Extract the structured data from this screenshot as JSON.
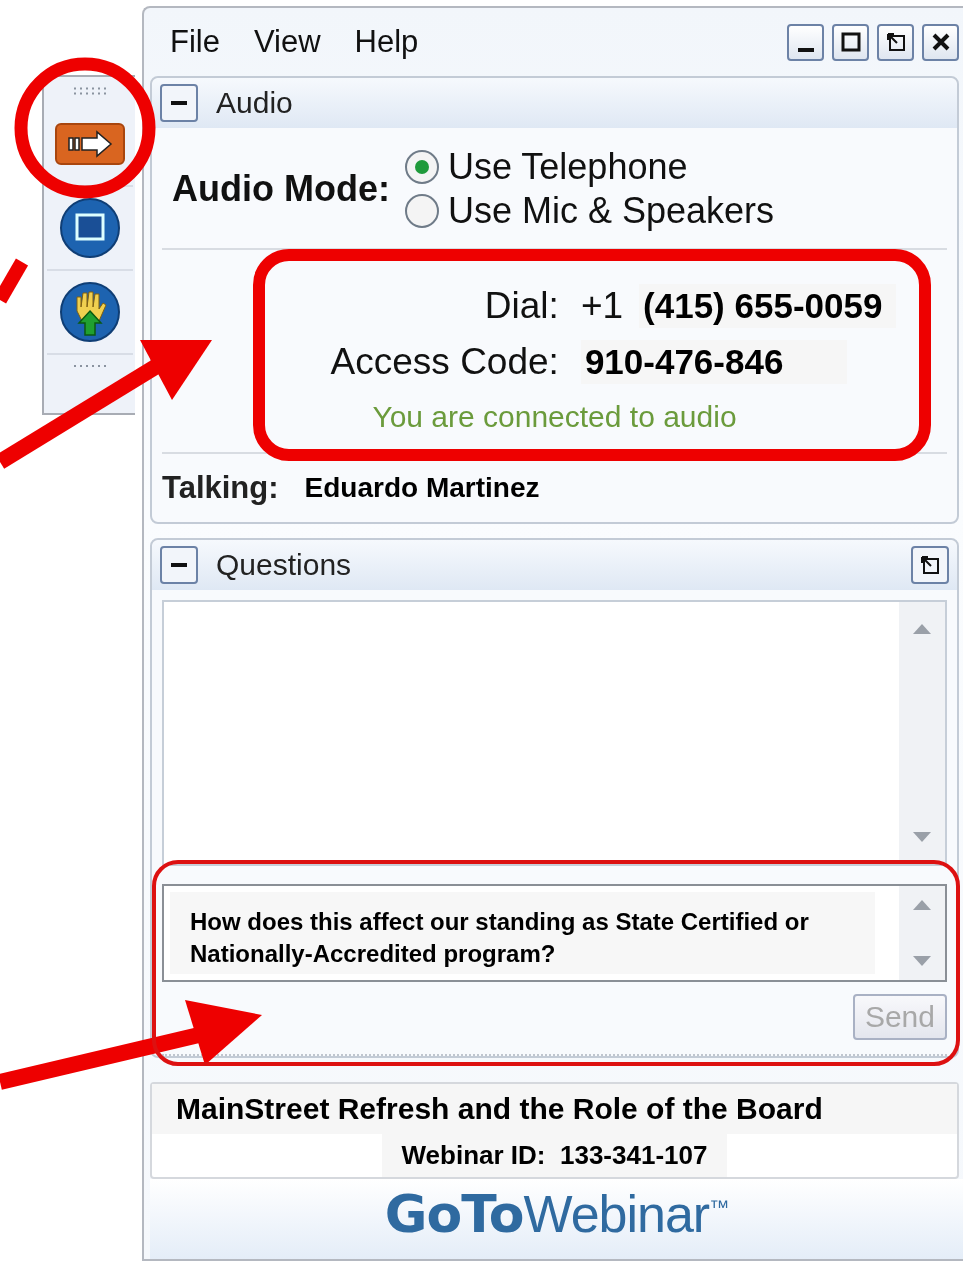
{
  "menu": [
    "File",
    "View",
    "Help"
  ],
  "audio": {
    "title": "Audio",
    "expanded": true,
    "mode_label": "Audio Mode:",
    "options": [
      {
        "label": "Use Telephone",
        "selected": true
      },
      {
        "label": "Use Mic & Speakers",
        "selected": false
      }
    ],
    "dial_label": "Dial:",
    "dial_prefix": "+1",
    "dial_number": "(415) 655-0059",
    "access_label": "Access Code:",
    "access_code": "910-476-846",
    "status": "You are connected to audio",
    "talking_label": "Talking:",
    "talking_name": "Eduardo Martinez"
  },
  "questions": {
    "title": "Questions",
    "expanded": true,
    "question_text": "How does this affect our standing as State Certified or Nationally-Accredited program?",
    "send": {
      "label": "Send",
      "disabled": true
    }
  },
  "session": {
    "title": "MainStreet Refresh and the Role of the Board",
    "webinar_id_label": "Webinar ID:",
    "webinar_id": "133-341-107"
  },
  "logo": {
    "bold": "GoTo",
    "light": "Webinar",
    "mark": "™"
  }
}
